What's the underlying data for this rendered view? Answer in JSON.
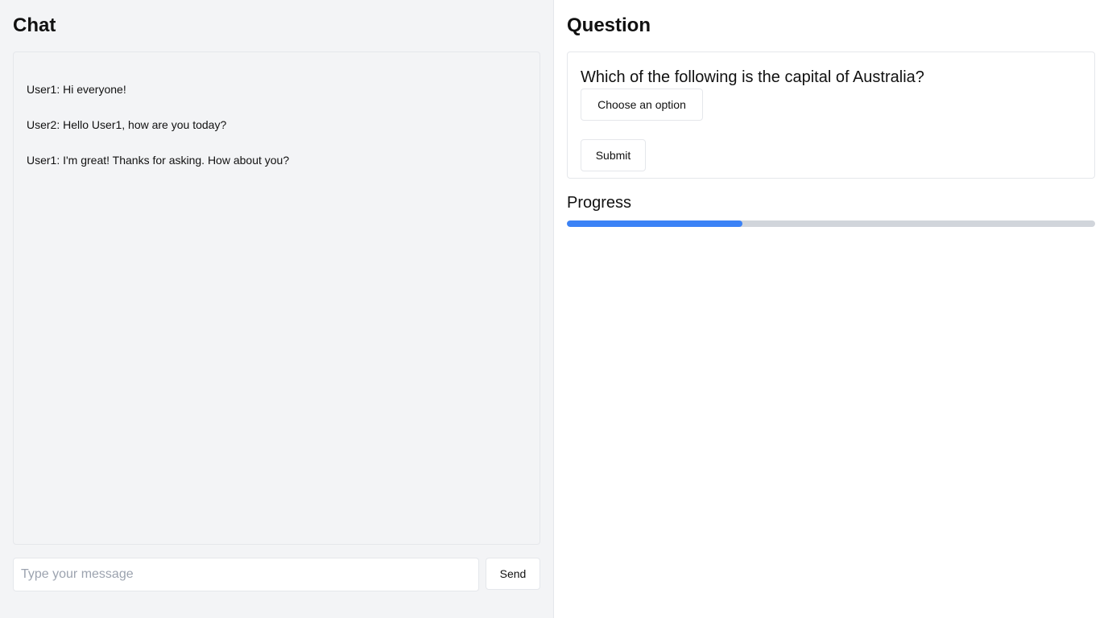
{
  "chat": {
    "title": "Chat",
    "messages": [
      "User1: Hi everyone!",
      "User2: Hello User1, how are you today?",
      "User1: I'm great! Thanks for asking. How about you?"
    ],
    "input_placeholder": "Type your message",
    "input_value": "",
    "send_label": "Send"
  },
  "question": {
    "title": "Question",
    "text": "Which of the following is the capital of Australia?",
    "select_label": "Choose an option",
    "submit_label": "Submit"
  },
  "progress": {
    "label": "Progress",
    "fraction": 0.333
  },
  "colors": {
    "accent": "#3b82f6",
    "track": "#d1d5db",
    "panel_bg": "#f3f4f6",
    "border": "#e5e7eb"
  }
}
